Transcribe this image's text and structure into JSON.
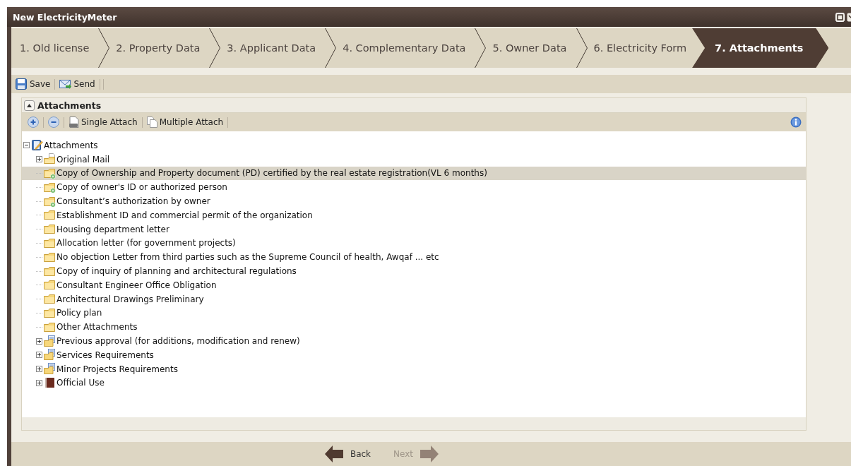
{
  "window": {
    "title": "New ElectricityMeter"
  },
  "tabs": [
    {
      "label": "1. Old license",
      "selected": false
    },
    {
      "label": "2. Property Data",
      "selected": false
    },
    {
      "label": "3. Applicant Data",
      "selected": false
    },
    {
      "label": "4. Complementary Data",
      "selected": false
    },
    {
      "label": "5. Owner Data",
      "selected": false
    },
    {
      "label": "6. Electricity Form",
      "selected": false
    },
    {
      "label": "7. Attachments",
      "selected": true
    }
  ],
  "toolbar": [
    {
      "label": "Save",
      "kind": "save"
    },
    {
      "label": "Send",
      "kind": "send"
    }
  ],
  "panel": {
    "title": "Attachments",
    "expanded": true,
    "toolbar": [
      {
        "kind": "add"
      },
      {
        "kind": "remove"
      },
      {
        "kind": "single",
        "label": "Single Attach"
      },
      {
        "kind": "multiple",
        "label": "Multiple Attach"
      }
    ],
    "tree": [
      {
        "label": "Attachments",
        "kind": "root",
        "expanded": true,
        "selected": false,
        "children": [
          {
            "label": "Original Mail",
            "kind": "mail",
            "expanded": false,
            "selected": false
          },
          {
            "label": "Copy of Ownership and Property document (PD) certified by the real estate registration(VL 6 months)",
            "kind": "required",
            "selected": true
          },
          {
            "label": "Copy of owner's ID or authorized person",
            "kind": "required",
            "selected": false
          },
          {
            "label": "Consultant’s authorization by owner",
            "kind": "required",
            "selected": false
          },
          {
            "label": "Establishment ID and commercial permit of the organization",
            "kind": "folder",
            "selected": false
          },
          {
            "label": "Housing department letter",
            "kind": "folder",
            "selected": false
          },
          {
            "label": "Allocation letter (for government projects)",
            "kind": "folder",
            "selected": false
          },
          {
            "label": "No objection Letter from third parties such as the Supreme Council of health, Awqaf ... etc",
            "kind": "folder",
            "selected": false
          },
          {
            "label": "Copy of inquiry of planning and architectural regulations",
            "kind": "folder",
            "selected": false
          },
          {
            "label": "Consultant Engineer Office Obligation",
            "kind": "folder",
            "selected": false
          },
          {
            "label": "Architectural Drawings Preliminary",
            "kind": "folder",
            "selected": false
          },
          {
            "label": "Policy plan",
            "kind": "folder",
            "selected": false
          },
          {
            "label": "Other Attachments",
            "kind": "folder",
            "selected": false
          },
          {
            "label": "Previous approval (for additions, modification and renew)",
            "kind": "list",
            "expanded": false,
            "selected": false
          },
          {
            "label": "Services Requirements",
            "kind": "list",
            "expanded": false,
            "selected": false
          },
          {
            "label": "Minor Projects Requirements",
            "kind": "list",
            "expanded": false,
            "selected": false
          },
          {
            "label": "Official Use",
            "kind": "book",
            "expanded": false,
            "selected": false
          }
        ]
      }
    ]
  },
  "nav": {
    "back": {
      "label": "Back",
      "disabled": false
    },
    "next": {
      "label": "Next",
      "disabled": true
    }
  }
}
